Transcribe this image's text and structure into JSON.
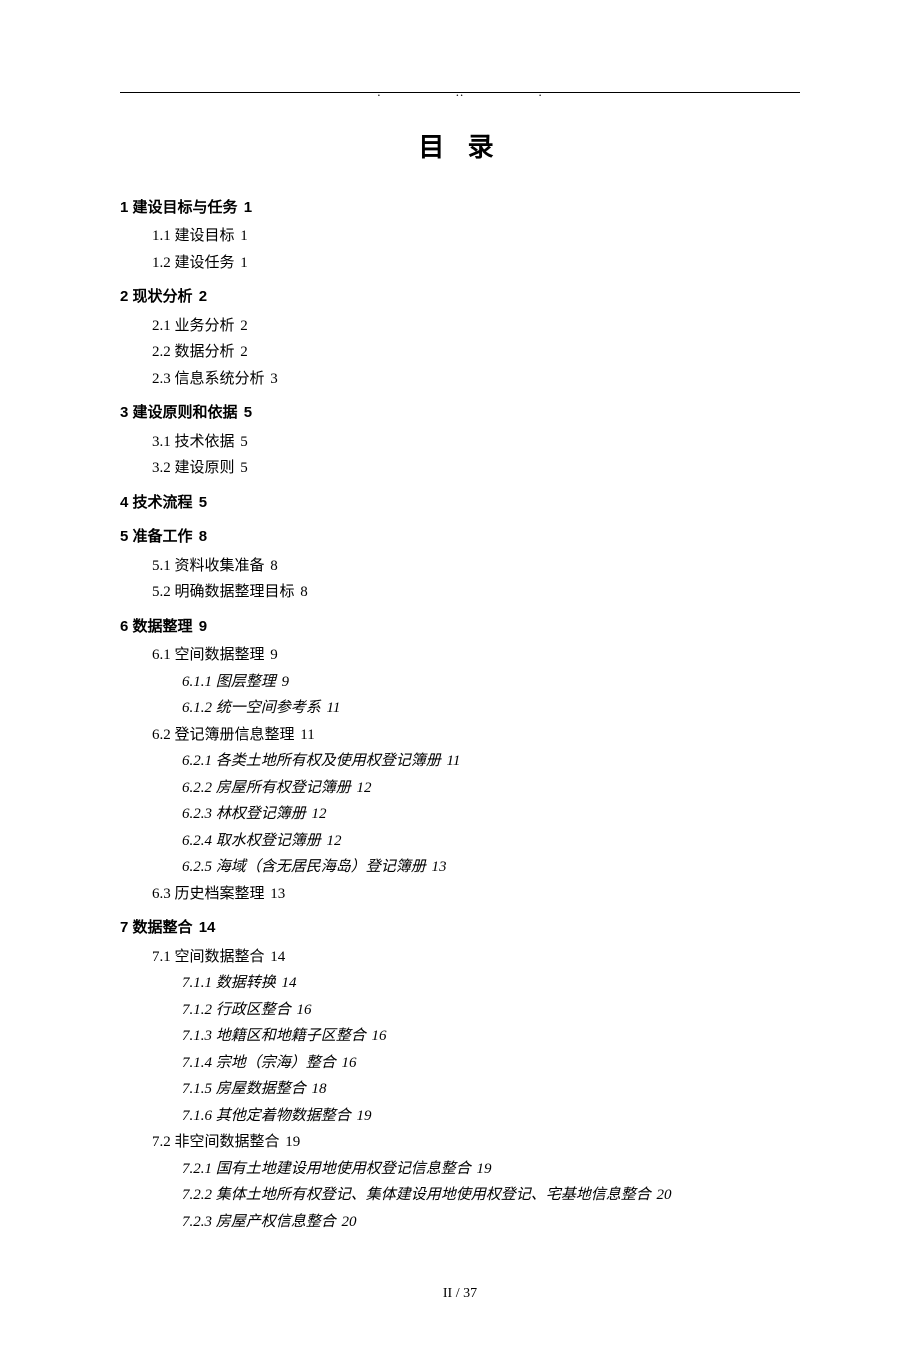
{
  "title": "目 录",
  "header_dots": {
    "left": ".",
    "mid": "..",
    "right": "."
  },
  "footer": "II / 37",
  "toc": [
    {
      "level": 1,
      "num": "1",
      "label": "建设目标与任务",
      "page": "1"
    },
    {
      "level": 2,
      "num": "1.1",
      "label": "建设目标",
      "page": "1"
    },
    {
      "level": 2,
      "num": "1.2",
      "label": "建设任务",
      "page": "1"
    },
    {
      "level": 1,
      "num": "2",
      "label": "现状分析",
      "page": "2"
    },
    {
      "level": 2,
      "num": "2.1",
      "label": "业务分析",
      "page": "2"
    },
    {
      "level": 2,
      "num": "2.2",
      "label": "数据分析",
      "page": "2"
    },
    {
      "level": 2,
      "num": "2.3",
      "label": "信息系统分析",
      "page": "3"
    },
    {
      "level": 1,
      "num": "3",
      "label": "建设原则和依据",
      "page": "5"
    },
    {
      "level": 2,
      "num": "3.1",
      "label": "技术依据",
      "page": "5"
    },
    {
      "level": 2,
      "num": "3.2",
      "label": "建设原则",
      "page": "5"
    },
    {
      "level": 1,
      "num": "4",
      "label": "技术流程",
      "page": "5"
    },
    {
      "level": 1,
      "num": "5",
      "label": "准备工作",
      "page": "8"
    },
    {
      "level": 2,
      "num": "5.1",
      "label": "资料收集准备",
      "page": "8"
    },
    {
      "level": 2,
      "num": "5.2",
      "label": "明确数据整理目标",
      "page": "8"
    },
    {
      "level": 1,
      "num": "6",
      "label": "数据整理",
      "page": "9"
    },
    {
      "level": 2,
      "num": "6.1",
      "label": "空间数据整理",
      "page": "9"
    },
    {
      "level": 3,
      "num": "6.1.1",
      "label": "图层整理",
      "page": "9"
    },
    {
      "level": 3,
      "num": "6.1.2",
      "label": "统一空间参考系",
      "page": "11"
    },
    {
      "level": 2,
      "num": "6.2",
      "label": "登记簿册信息整理",
      "page": "11"
    },
    {
      "level": 3,
      "num": "6.2.1",
      "label": "各类土地所有权及使用权登记簿册",
      "page": "11"
    },
    {
      "level": 3,
      "num": "6.2.2",
      "label": "房屋所有权登记簿册",
      "page": "12"
    },
    {
      "level": 3,
      "num": "6.2.3",
      "label": "林权登记簿册",
      "page": "12"
    },
    {
      "level": 3,
      "num": "6.2.4",
      "label": "取水权登记簿册",
      "page": "12"
    },
    {
      "level": 3,
      "num": "6.2.5",
      "label": "海域（含无居民海岛）登记簿册",
      "page": "13"
    },
    {
      "level": 2,
      "num": "6.3",
      "label": "历史档案整理",
      "page": "13"
    },
    {
      "level": 1,
      "num": "7",
      "label": "数据整合",
      "page": "14"
    },
    {
      "level": 2,
      "num": "7.1",
      "label": "空间数据整合",
      "page": "14"
    },
    {
      "level": 3,
      "num": "7.1.1",
      "label": "数据转换",
      "page": "14"
    },
    {
      "level": 3,
      "num": "7.1.2",
      "label": "行政区整合",
      "page": "16"
    },
    {
      "level": 3,
      "num": "7.1.3",
      "label": "地籍区和地籍子区整合",
      "page": "16"
    },
    {
      "level": 3,
      "num": "7.1.4",
      "label": "宗地（宗海）整合",
      "page": "16"
    },
    {
      "level": 3,
      "num": "7.1.5",
      "label": "房屋数据整合",
      "page": "18"
    },
    {
      "level": 3,
      "num": "7.1.6",
      "label": "其他定着物数据整合",
      "page": "19"
    },
    {
      "level": 2,
      "num": "7.2",
      "label": "非空间数据整合",
      "page": "19"
    },
    {
      "level": 3,
      "num": "7.2.1",
      "label": "国有土地建设用地使用权登记信息整合",
      "page": "19"
    },
    {
      "level": 3,
      "num": "7.2.2",
      "label": "集体土地所有权登记、集体建设用地使用权登记、宅基地信息整合",
      "page": "20"
    },
    {
      "level": 3,
      "num": "7.2.3",
      "label": "房屋产权信息整合",
      "page": "20"
    }
  ]
}
